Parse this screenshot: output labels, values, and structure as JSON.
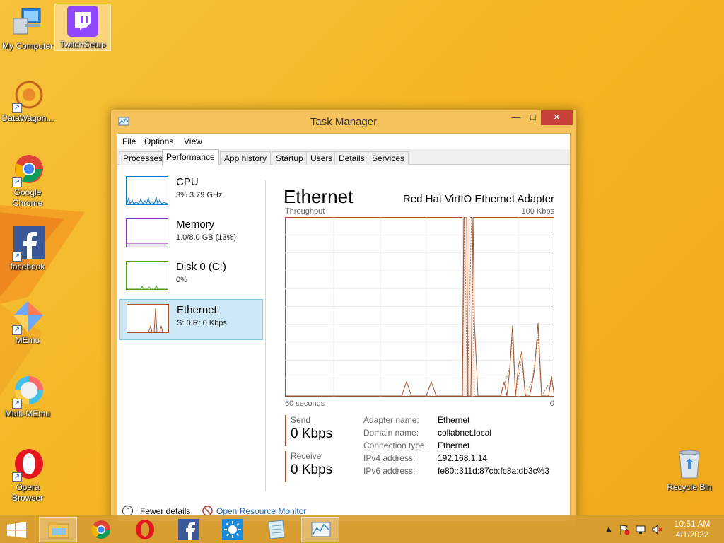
{
  "desktop": {
    "icons": [
      {
        "label": "My Computer"
      },
      {
        "label": "TwitchSetup"
      },
      {
        "label": "DataWagon..."
      },
      {
        "label": "Google Chrome"
      },
      {
        "label": "facebook"
      },
      {
        "label": "MEmu"
      },
      {
        "label": "Multi-MEmu"
      },
      {
        "label": "Opera Browser"
      },
      {
        "label": "Recycle Bin"
      }
    ]
  },
  "window": {
    "title": "Task Manager",
    "controls": {
      "minimize": "—",
      "maximize": "□",
      "close": "✕"
    }
  },
  "menu": {
    "file": "File",
    "options": "Options",
    "view": "View"
  },
  "tabs": [
    {
      "label": "Processes"
    },
    {
      "label": "Performance"
    },
    {
      "label": "App history"
    },
    {
      "label": "Startup"
    },
    {
      "label": "Users"
    },
    {
      "label": "Details"
    },
    {
      "label": "Services"
    }
  ],
  "active_tab": "Performance",
  "sidebar": [
    {
      "name": "CPU",
      "sub": "3% 3.79 GHz",
      "color": "#1779ba"
    },
    {
      "name": "Memory",
      "sub": "1.0/8.0 GB (13%)",
      "color": "#8b3aa6"
    },
    {
      "name": "Disk 0 (C:)",
      "sub": "0%",
      "color": "#4d9a1f"
    },
    {
      "name": "Ethernet",
      "sub": "S: 0 R: 0 Kbps",
      "color": "#a0522d"
    }
  ],
  "detail": {
    "title": "Ethernet",
    "adapter": "Red Hat VirtIO Ethernet Adapter",
    "throughput_label": "Throughput",
    "max_label": "100 Kbps",
    "time_label": "60 seconds",
    "min_label": "0",
    "send_label": "Send",
    "send_value": "0 Kbps",
    "receive_label": "Receive",
    "receive_value": "0 Kbps",
    "properties": [
      {
        "key": "Adapter name:",
        "value": "Ethernet"
      },
      {
        "key": "Domain name:",
        "value": "collabnet.local"
      },
      {
        "key": "Connection type:",
        "value": "Ethernet"
      },
      {
        "key": "IPv4 address:",
        "value": "192.168.1.14"
      },
      {
        "key": "IPv6 address:",
        "value": "fe80::311d:87cb:fc8a:db3c%3"
      }
    ]
  },
  "footer": {
    "fewer_details": "Fewer details",
    "open_resmon": "Open Resource Monitor"
  },
  "taskbar": {
    "clock_time": "10:51 AM",
    "clock_date": "4/1/2022"
  },
  "colors": {
    "accent_ethernet": "#a0522d",
    "window_frame": "#f5c25b",
    "close_button": "#c7413a"
  }
}
